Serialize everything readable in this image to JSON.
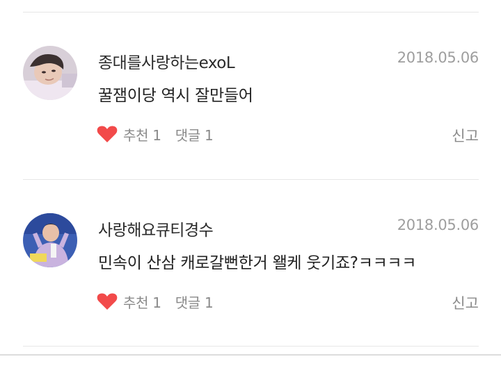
{
  "comments": [
    {
      "username": "종대를사랑하는exoL",
      "date": "2018.05.06",
      "content": "꿀잼이당 역시 잘만들어",
      "likes_label": "추천 1",
      "replies_label": "댓글 1",
      "report_label": "신고",
      "avatar": "profile-photo-young-man-lying-down"
    },
    {
      "username": "사랑해요큐티경수",
      "date": "2018.05.06",
      "content": "민속이 산삼 캐로갈뻔한거 왤케 웃기죠?ㅋㅋㅋㅋ",
      "likes_label": "추천 1",
      "replies_label": "댓글 1",
      "report_label": "신고",
      "avatar": "profile-photo-man-purple-jacket"
    }
  ],
  "icons": {
    "like": "heart-icon"
  },
  "colors": {
    "heart": "#f24a4a",
    "meta_text": "#8a8a8a",
    "date_text": "#9e9e9e"
  }
}
